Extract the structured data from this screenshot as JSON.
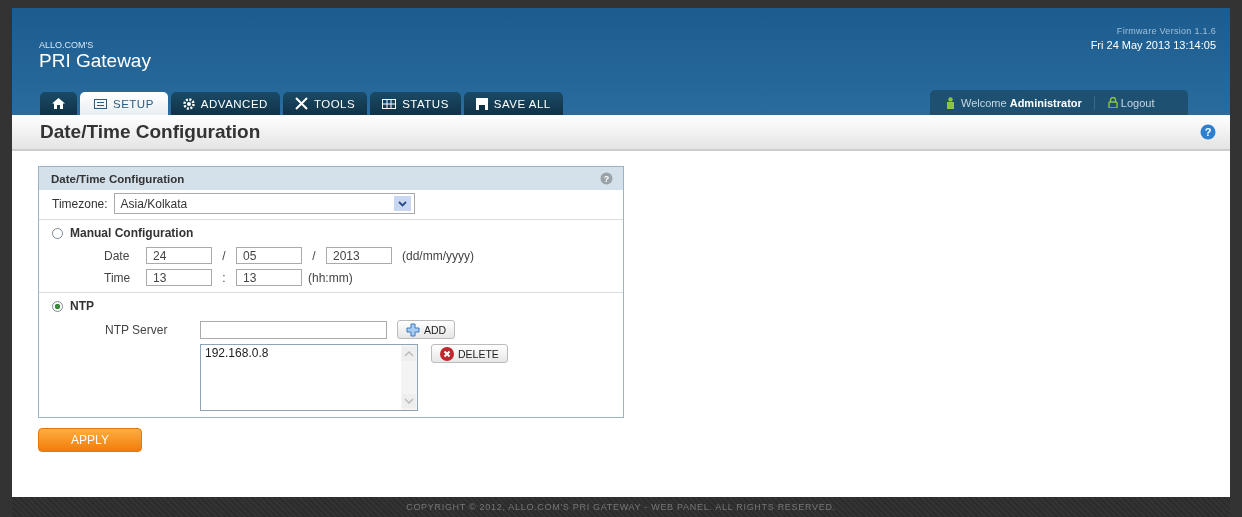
{
  "header": {
    "brand_small": "ALLO.COM'S",
    "brand": "PRI Gateway",
    "firmware": "Firmware Version 1.1.6",
    "datetime": "Fri 24 May 2013 13:14:05"
  },
  "tabs": [
    {
      "kind": "home",
      "selected": false
    },
    {
      "kind": "setup",
      "label": "SETUP",
      "selected": true
    },
    {
      "kind": "advanced",
      "label": "ADVANCED",
      "selected": false
    },
    {
      "kind": "tools",
      "label": "TOOLS",
      "selected": false
    },
    {
      "kind": "status",
      "label": "STATUS",
      "selected": false
    },
    {
      "kind": "save",
      "label": "SAVE ALL",
      "selected": false
    }
  ],
  "user": {
    "welcome": "Welcome",
    "name": "Administrator",
    "logout": "Logout"
  },
  "page_title": "Date/Time Configuration",
  "page_help": "?",
  "panel": {
    "title": "Date/Time Configuration",
    "help": "?",
    "timezone_label": "Timezone:",
    "timezone": "Asia/Kolkata",
    "modes": [
      {
        "label": "Manual Configuration",
        "selected": false
      },
      {
        "label": "NTP",
        "selected": true
      }
    ],
    "date": {
      "label": "Date",
      "day": "24",
      "sep1": "/",
      "month": "05",
      "sep2": "/",
      "year": "2013",
      "format": "(dd/mm/yyyy)"
    },
    "time": {
      "label": "Time",
      "hour": "13",
      "sep": ":",
      "minute": "13",
      "format": "(hh:mm)"
    },
    "ntp_label": "NTP Server",
    "add": "ADD",
    "servers": [
      "192.168.0.8"
    ],
    "delete": "DELETE"
  },
  "apply": "APPLY",
  "footer": "COPYRIGHT © 2012, ALLO.COM'S PRI GATEWAY - WEB PANEL. ALL RIGHTS RESERVED."
}
